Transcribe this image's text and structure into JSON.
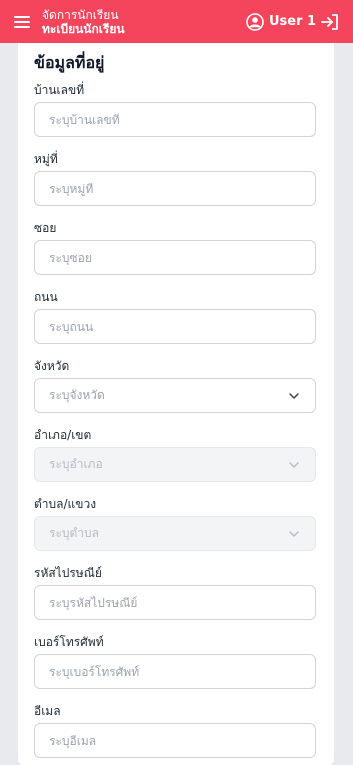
{
  "header": {
    "app_title": "จัดการนักเรียน",
    "app_subtitle": "ทะเบียนนักเรียน",
    "user_name": "User 1"
  },
  "section": {
    "title": "ข้อมูลที่อยู่"
  },
  "fields": {
    "house_no": {
      "label": "บ้านเลขที่",
      "placeholder": "ระบุบ้านเลขที่"
    },
    "moo": {
      "label": "หมู่ที่",
      "placeholder": "ระบุหมู่ที่"
    },
    "soi": {
      "label": "ซอย",
      "placeholder": "ระบุซอย"
    },
    "road": {
      "label": "ถนน",
      "placeholder": "ระบุถนน"
    },
    "province": {
      "label": "จังหวัด",
      "placeholder": "ระบุจังหวัด"
    },
    "district": {
      "label": "อำเภอ/เขต",
      "placeholder": "ระบุอำเภอ"
    },
    "subdistrict": {
      "label": "ตำบล/แขวง",
      "placeholder": "ระบุตำบล"
    },
    "postal_code": {
      "label": "รหัสไปรษณีย์",
      "placeholder": "ระบุรหัสไปรษณีย์"
    },
    "phone": {
      "label": "เบอร์โทรศัพท์",
      "placeholder": "ระบุเบอร์โทรศัพท์"
    },
    "email": {
      "label": "อีเมล",
      "placeholder": "ระบุอีเมล"
    }
  },
  "colors": {
    "header_bg": "#f5455c",
    "page_bg": "#e9eaee"
  },
  "icons": {
    "menu": "hamburger-menu-icon",
    "user": "user-circle-icon",
    "logout": "logout-icon",
    "chevron": "chevron-down-icon"
  }
}
